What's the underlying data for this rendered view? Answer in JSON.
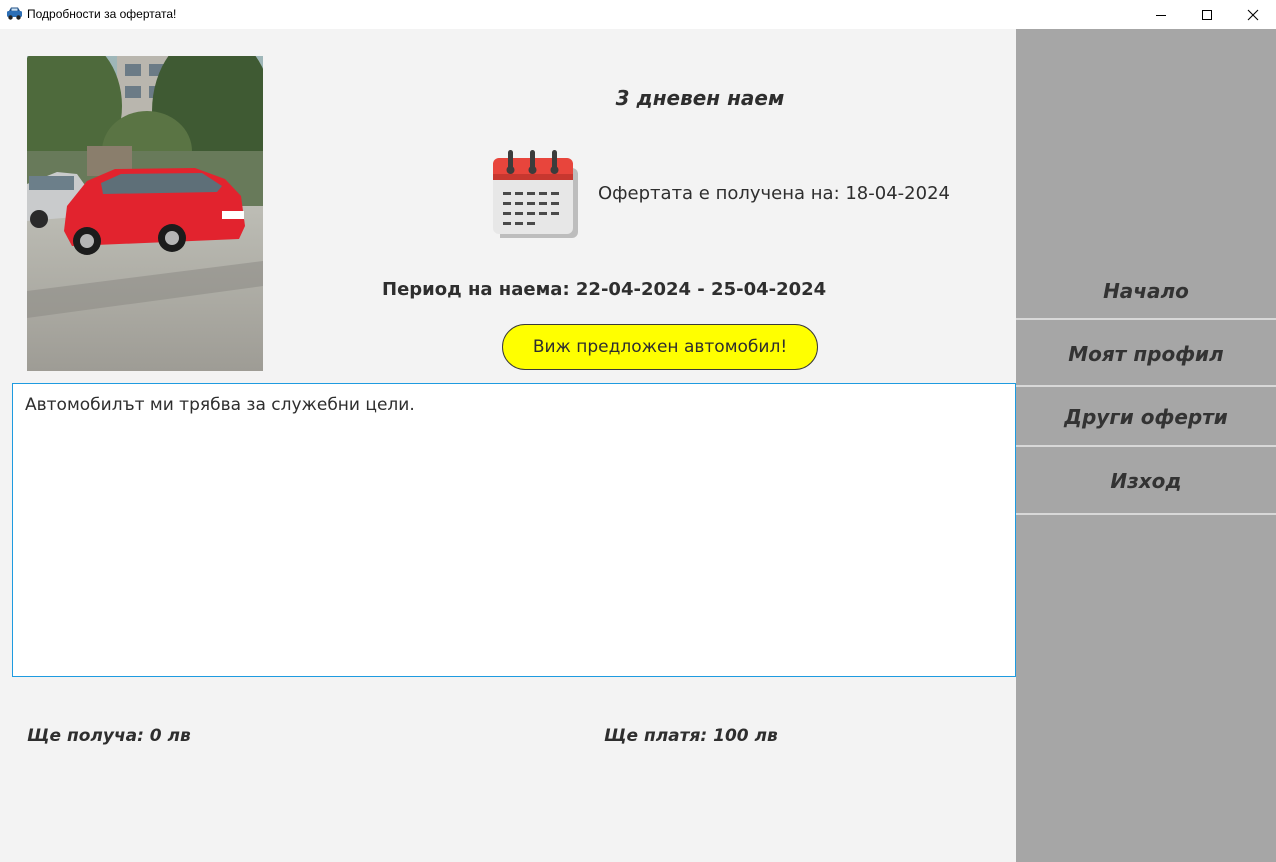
{
  "window": {
    "title": "Подробности за офертата!",
    "icon": "car-icon",
    "controls": [
      "minimize-icon",
      "maximize-icon",
      "close-icon"
    ]
  },
  "offer": {
    "heading": "3 дневен наем",
    "received_label": "Офертата е получена на: 18-04-2024",
    "period_label": "Период на наема: 22-04-2024 - 25-04-2024",
    "view_car_button": "Виж предложен автомобил!",
    "message": "Автомобилът ми трябва за служебни цели.",
    "receive_amount": "Ще получа: 0 лв",
    "pay_amount": "Ще платя: 100 лв"
  },
  "sidebar": {
    "items": [
      {
        "label": "Начало"
      },
      {
        "label": "Моят профил"
      },
      {
        "label": "Други оферти"
      },
      {
        "label": "Изход"
      }
    ]
  },
  "colors": {
    "content_bg": "#f3f3f3",
    "sidebar_bg": "#a6a6a6",
    "button_bg": "#ffff00",
    "focus_border": "#1e9be0",
    "text": "#2e2e2e"
  }
}
